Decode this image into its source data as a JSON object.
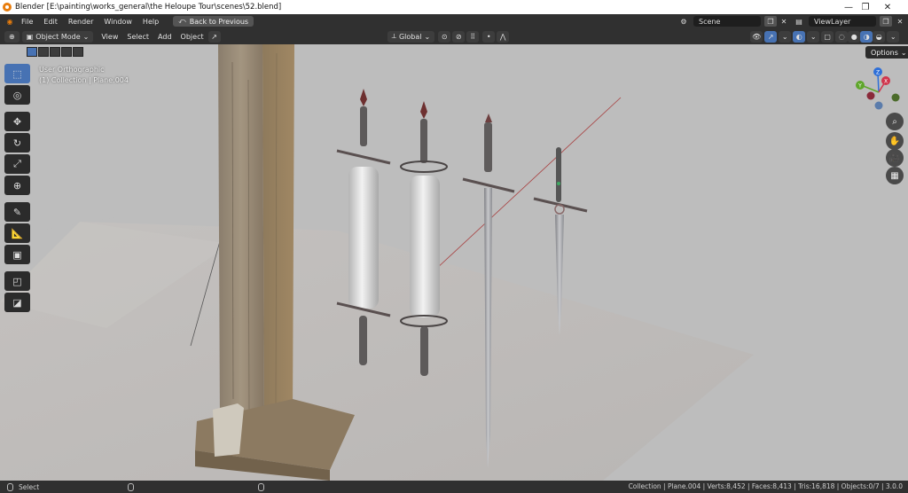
{
  "window": {
    "title": "Blender [E:\\painting\\works_general\\the Heloupe Tour\\scenes\\52.blend]",
    "controls": {
      "minimize": "—",
      "restore": "❐",
      "close": "✕"
    }
  },
  "menu": {
    "items": [
      "File",
      "Edit",
      "Render",
      "Window",
      "Help"
    ],
    "back_button": "Back to Previous",
    "scene_name": "Scene",
    "view_layer": "ViewLayer"
  },
  "header": {
    "mode": "Object Mode",
    "menus": [
      "View",
      "Select",
      "Add",
      "Object"
    ],
    "transform_orientation": "Global"
  },
  "viewport": {
    "view_name": "User Orthographic",
    "collection_info": "(1) Collection | Plane.004",
    "options_label": "Options",
    "gizmo": {
      "z": "Z",
      "y": "Y",
      "x": "X"
    }
  },
  "status": {
    "left_action": "Select",
    "stats": "Collection | Plane.004 | Verts:8,452 | Faces:8,413 | Tris:16,818 | Objects:0/7 | 3.0.0"
  },
  "colors": {
    "accent": "#4772b3",
    "viewport_bg": "#bdbdbd",
    "blender_orange": "#e87d0d"
  },
  "icons": {
    "toolbar": [
      "select-box-icon",
      "cursor-icon",
      "move-icon",
      "rotate-icon",
      "scale-icon",
      "transform-icon",
      "annotate-icon",
      "measure-icon",
      "add-cube-icon",
      "shear-icon",
      "extrude-icon"
    ],
    "nav": [
      "zoom-icon",
      "hand-pan-icon",
      "camera-icon",
      "grid-icon"
    ]
  }
}
